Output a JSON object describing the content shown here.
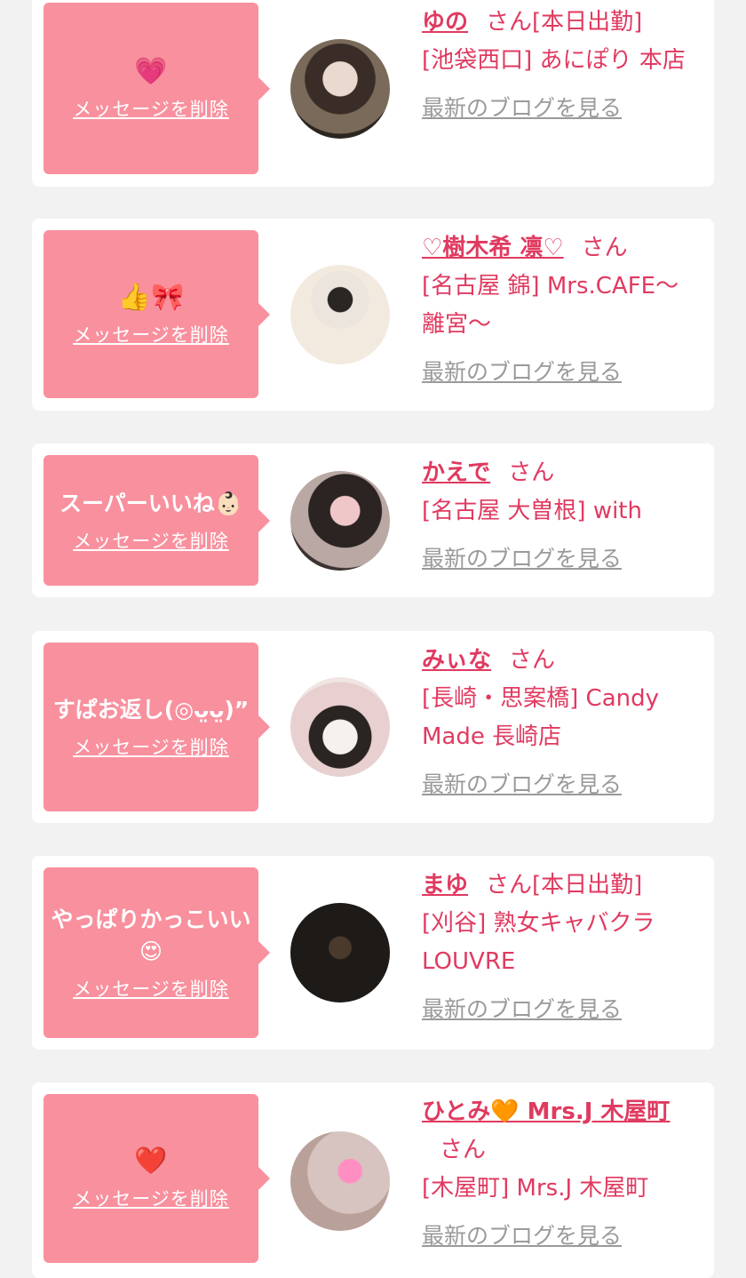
{
  "delete_label": "メッセージを削除",
  "blog_label": "最新のブログを見る",
  "honorific": "さん",
  "entries": [
    {
      "message": "💗",
      "name": "ゆの",
      "extra": "[本日出勤]",
      "shop": "[池袋西口] あにぽり 本店"
    },
    {
      "message": "👍🎀",
      "name": "♡樹木希 凛♡",
      "extra": "",
      "shop": "[名古屋 錦] Mrs.CAFE～離宮～"
    },
    {
      "message": "スーパーいいね👶🏻",
      "name": "かえで",
      "extra": "",
      "shop": "[名古屋 大曽根] with"
    },
    {
      "message": "すぱお返し(◎ᴗ̤ᴗ̤)”",
      "name": "みぃな",
      "extra": "",
      "shop": "[長崎・思案橋] Candy Made 長崎店"
    },
    {
      "message": "やっぱりかっこいい😍",
      "name": "まゆ",
      "extra": "[本日出勤]",
      "shop": "[刈谷] 熟女キャバクラ LOUVRE"
    },
    {
      "message": "❤️",
      "name": "ひとみ🧡 Mrs.J 木屋町",
      "extra": "",
      "shop": "[木屋町] Mrs.J 木屋町"
    }
  ],
  "colors": {
    "accent": "#e03a60",
    "bubble": "#f9909e",
    "muted": "#9a9a9a",
    "background": "#f2f2f2"
  }
}
